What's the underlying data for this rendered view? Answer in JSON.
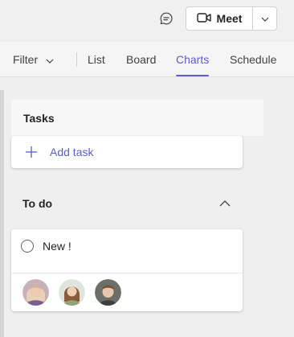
{
  "header": {
    "chat_icon": "chat-bubble-icon",
    "meet_label": "Meet",
    "meet_icon": "video-camera-icon",
    "meet_dropdown_icon": "chevron-down-icon"
  },
  "tabbar": {
    "filter_label": "Filter",
    "tabs": [
      {
        "label": "List"
      },
      {
        "label": "Board"
      },
      {
        "label": "Charts"
      },
      {
        "label": "Schedule"
      }
    ],
    "active_tab": "Charts"
  },
  "tasks": {
    "title": "Tasks",
    "add_task_label": "Add task"
  },
  "bucket": {
    "title": "To do",
    "collapse_icon": "chevron-up-icon",
    "items": [
      {
        "name": "New !",
        "assignees": [
          "avatar-1",
          "avatar-2",
          "avatar-3"
        ]
      }
    ]
  },
  "colors": {
    "accent": "#5b5fc7",
    "background": "#efefef",
    "card": "#ffffff"
  }
}
